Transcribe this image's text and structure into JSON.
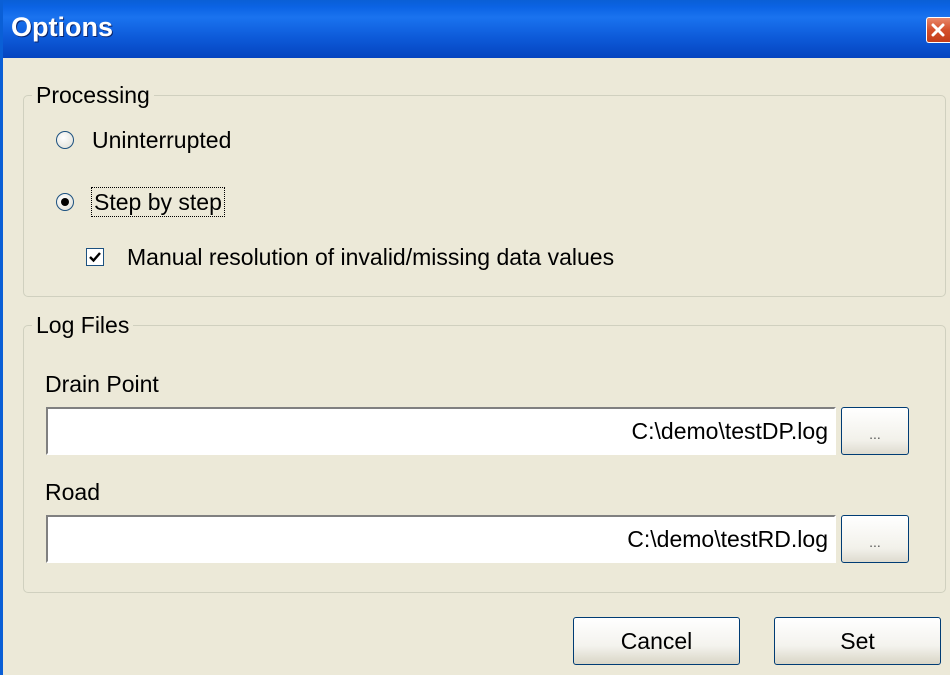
{
  "window": {
    "title": "Options"
  },
  "processing": {
    "legend": "Processing",
    "options": [
      {
        "label": "Uninterrupted",
        "selected": false
      },
      {
        "label": "Step by step",
        "selected": true
      }
    ],
    "manual_resolution": {
      "label": "Manual resolution of invalid/missing data values",
      "checked": true
    }
  },
  "log_files": {
    "legend": "Log Files",
    "drain_point": {
      "label": "Drain Point",
      "value": "C:\\demo\\testDP.log",
      "browse_label": "..."
    },
    "road": {
      "label": "Road",
      "value": "C:\\demo\\testRD.log",
      "browse_label": "..."
    }
  },
  "buttons": {
    "cancel": "Cancel",
    "set": "Set"
  },
  "colors": {
    "titlebar": "#0a5fd6",
    "dialog_bg": "#ece9d8",
    "close_button": "#d4502c"
  },
  "icons": {
    "close": "close-icon",
    "check": "check-icon"
  }
}
